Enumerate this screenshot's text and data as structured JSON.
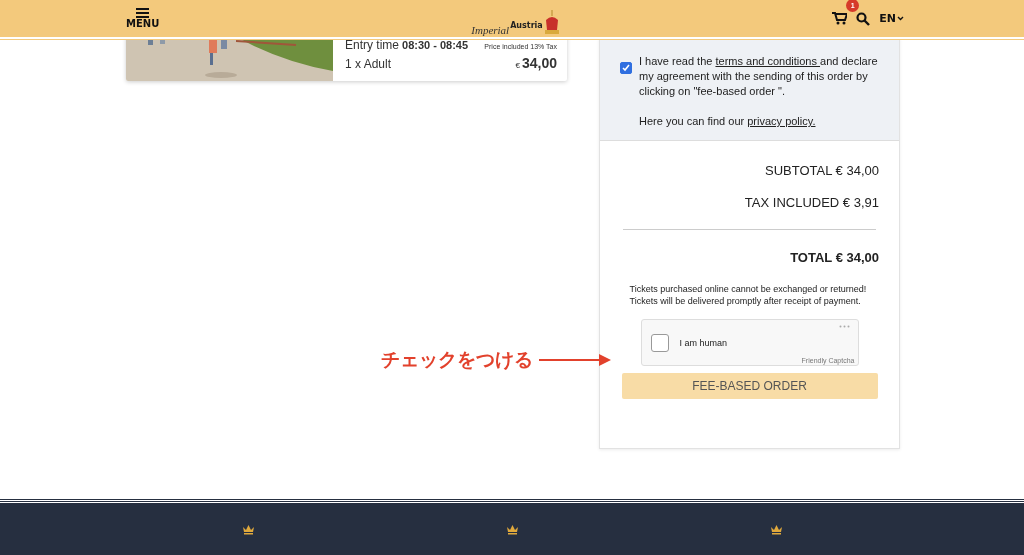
{
  "header": {
    "menu_label": "MENU",
    "logo": {
      "word_1": "Imperial",
      "word_2": "Austria"
    },
    "cart_count": "1",
    "language": "EN"
  },
  "ticket": {
    "entry_time_label": "Entry time",
    "entry_time": "08:30 - 08:45",
    "tax_note": "Price included 13% Tax",
    "quantity": "1 x Adult",
    "currency": "€",
    "price": "34,00"
  },
  "order": {
    "consent": {
      "checked": true,
      "before": "I have read the ",
      "terms_link": "terms and conditions ",
      "after": "and declare my agreement with the sending of this order by clicking on \"fee-based order \".",
      "privacy_before": "Here you can find our ",
      "privacy_link": "privacy policy."
    },
    "subtotal": "SUBTOTAL € 34,00",
    "tax": "TAX INCLUDED € 3,91",
    "total": "TOTAL € 34,00",
    "notes": [
      "Tickets purchased online cannot be exchanged or returned!",
      "Tickets will be delivered promptly after receipt of payment."
    ],
    "captcha": {
      "label": "I am human",
      "checked": false,
      "brand": "Friendly Captcha"
    },
    "submit": "FEE-BASED ORDER"
  },
  "annotation": {
    "text": "チェックをつける"
  },
  "footer": {
    "kind": "crowns"
  }
}
